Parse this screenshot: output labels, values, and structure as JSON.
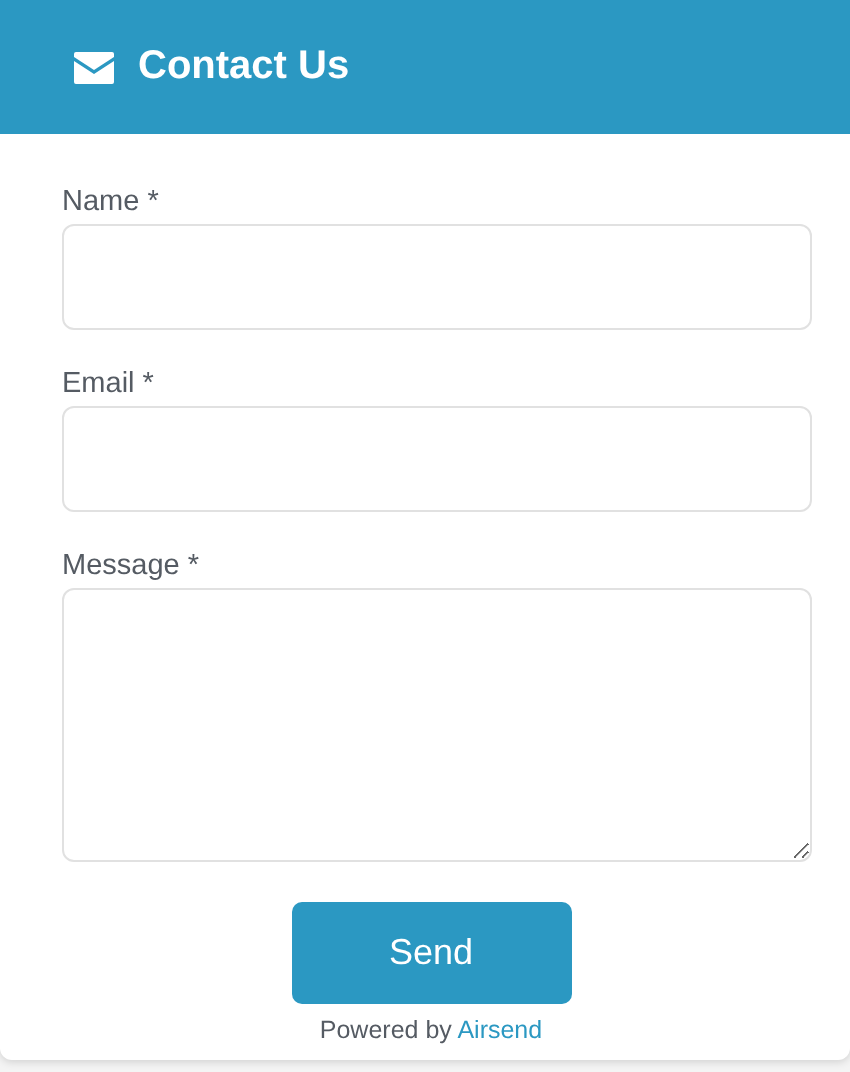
{
  "header": {
    "title": "Contact Us"
  },
  "fields": [
    {
      "label": "Name *",
      "kind": "input"
    },
    {
      "label": "Email *",
      "kind": "input"
    },
    {
      "label": "Message *",
      "kind": "textarea"
    }
  ],
  "submit": {
    "label": "Send"
  },
  "footer": {
    "text": "Powered by",
    "link": "Airsend"
  }
}
